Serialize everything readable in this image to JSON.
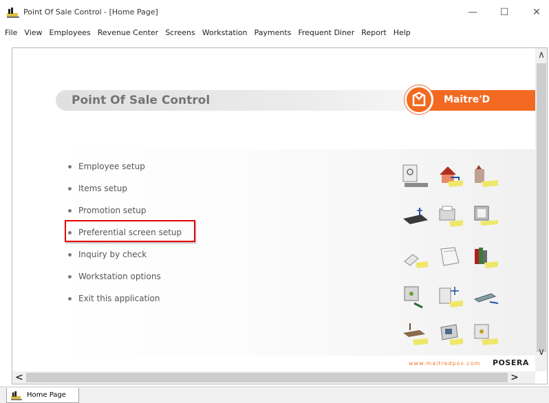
{
  "window": {
    "title": "Point Of Sale Control - [Home Page]",
    "minimize_glyph": "—",
    "maximize_glyph": "☐",
    "close_glyph": "✕"
  },
  "menubar": {
    "items": [
      "File",
      "View",
      "Employees",
      "Revenue Center",
      "Screens",
      "Workstation",
      "Payments",
      "Frequent Diner",
      "Report",
      "Help"
    ]
  },
  "page": {
    "header_title": "Point Of Sale Control",
    "brand_name": "Maitre'D",
    "menu_items": [
      "Employee setup",
      "Items setup",
      "Promotion setup",
      "Preferential screen setup",
      "Inquiry by check",
      "Workstation options",
      "Exit this application"
    ],
    "highlighted_item": "Preferential screen setup",
    "footer_url": "www.maitredpos.com",
    "footer_logo": "POSERA"
  },
  "icons": [
    "safe-icon",
    "house-icon",
    "building-icon",
    "keyboard-icon",
    "printer-icon",
    "monitor-icon",
    "hand-card-icon",
    "papers-icon",
    "books-icon",
    "terminal-icon",
    "workstation-icon",
    "network-icon",
    "table-icon",
    "screen-icon",
    "pos-icon"
  ],
  "scroll": {
    "up_glyph": "∧",
    "down_glyph": "∨",
    "left_glyph": "<",
    "right_glyph": ">"
  },
  "statusbar": {
    "tab_label": "Home Page"
  },
  "colors": {
    "brand": "#f26a21",
    "highlight": "#e60000",
    "title_gray": "#757575"
  }
}
